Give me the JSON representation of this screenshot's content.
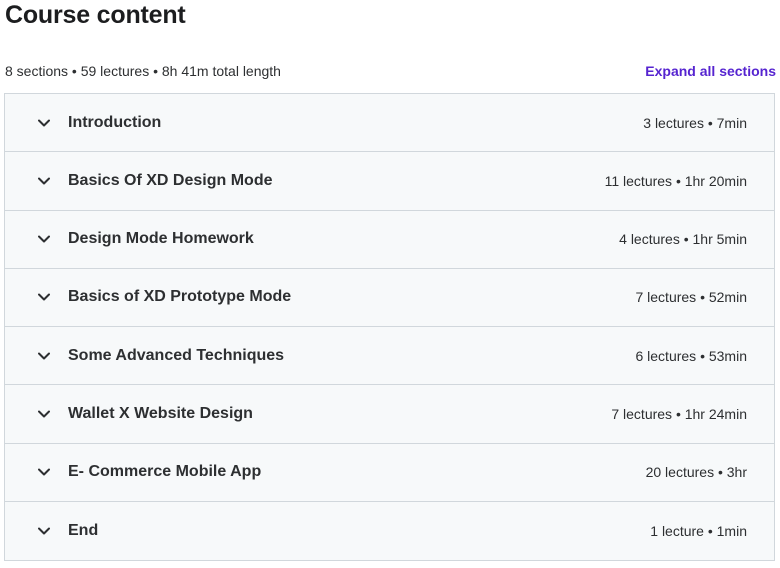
{
  "header": {
    "title": "Course content",
    "summary": "8 sections • 59 lectures • 8h 41m total length",
    "expand_label": "Expand all sections"
  },
  "colors": {
    "accent": "#5624d0",
    "section_bg": "#f7f9fa",
    "border": "#d1d7dc",
    "text": "#2d2f31"
  },
  "sections": [
    {
      "title": "Introduction",
      "meta": "3 lectures • 7min"
    },
    {
      "title": "Basics Of XD Design Mode",
      "meta": "11 lectures • 1hr 20min"
    },
    {
      "title": "Design Mode Homework",
      "meta": "4 lectures • 1hr 5min"
    },
    {
      "title": "Basics of XD Prototype Mode",
      "meta": "7 lectures • 52min"
    },
    {
      "title": "Some Advanced Techniques",
      "meta": "6 lectures • 53min"
    },
    {
      "title": "Wallet X Website Design",
      "meta": "7 lectures • 1hr 24min"
    },
    {
      "title": "E- Commerce Mobile App",
      "meta": "20 lectures • 3hr"
    },
    {
      "title": "End",
      "meta": "1 lecture • 1min"
    }
  ]
}
